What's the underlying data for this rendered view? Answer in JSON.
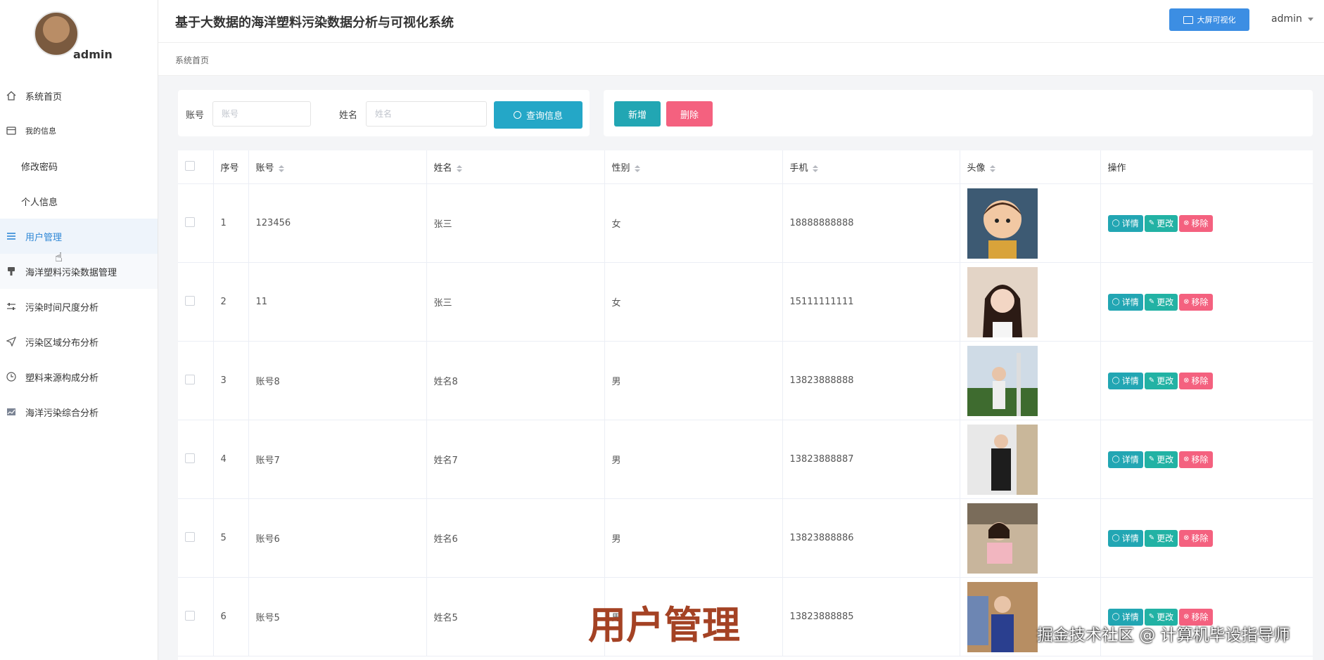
{
  "sidebar": {
    "user_name": "admin",
    "items": [
      {
        "label": "系统首页",
        "icon": "home-icon"
      },
      {
        "label": "我的信息",
        "icon": "card-icon"
      },
      {
        "label": "修改密码",
        "icon": ""
      },
      {
        "label": "个人信息",
        "icon": ""
      },
      {
        "label": "用户管理",
        "icon": "list-icon"
      },
      {
        "label": "海洋塑料污染数据管理",
        "icon": "brush-icon"
      },
      {
        "label": "污染时间尺度分析",
        "icon": "sliders-icon"
      },
      {
        "label": "污染区域分布分析",
        "icon": "navigation-icon"
      },
      {
        "label": "塑料来源构成分析",
        "icon": "clock-icon"
      },
      {
        "label": "海洋污染综合分析",
        "icon": "chart-icon"
      }
    ]
  },
  "header": {
    "title": "基于大数据的海洋塑料污染数据分析与可视化系统",
    "bigscreen_label": "大屏可视化",
    "admin_label": "admin"
  },
  "breadcrumb": "系统首页",
  "search": {
    "account_label": "账号",
    "account_placeholder": "账号",
    "name_label": "姓名",
    "name_placeholder": "姓名",
    "query_label": "查询信息"
  },
  "actions": {
    "add_label": "新增",
    "delete_label": "删除"
  },
  "table": {
    "headers": {
      "index": "序号",
      "account": "账号",
      "name": "姓名",
      "gender": "性别",
      "phone": "手机",
      "avatar": "头像",
      "ops": "操作"
    },
    "op_labels": {
      "detail": "详情",
      "edit": "更改",
      "remove": "移除"
    },
    "rows": [
      {
        "index": "1",
        "account": "123456",
        "name": "张三",
        "gender": "女",
        "phone": "18888888888"
      },
      {
        "index": "2",
        "account": "11",
        "name": "张三",
        "gender": "女",
        "phone": "15111111111"
      },
      {
        "index": "3",
        "account": "账号8",
        "name": "姓名8",
        "gender": "男",
        "phone": "13823888888"
      },
      {
        "index": "4",
        "account": "账号7",
        "name": "姓名7",
        "gender": "男",
        "phone": "13823888887"
      },
      {
        "index": "5",
        "account": "账号6",
        "name": "姓名6",
        "gender": "男",
        "phone": "13823888886"
      },
      {
        "index": "6",
        "account": "账号5",
        "name": "姓名5",
        "gender": "男",
        "phone": "13823888885"
      }
    ]
  },
  "overlay": {
    "title": "用户管理",
    "watermark": "掘金技术社区 @ 计算机毕设指导师"
  },
  "colors": {
    "accent": "#2f87d6",
    "teal": "#22a6b3",
    "pink": "#f4617f",
    "overlay": "#a44224"
  }
}
